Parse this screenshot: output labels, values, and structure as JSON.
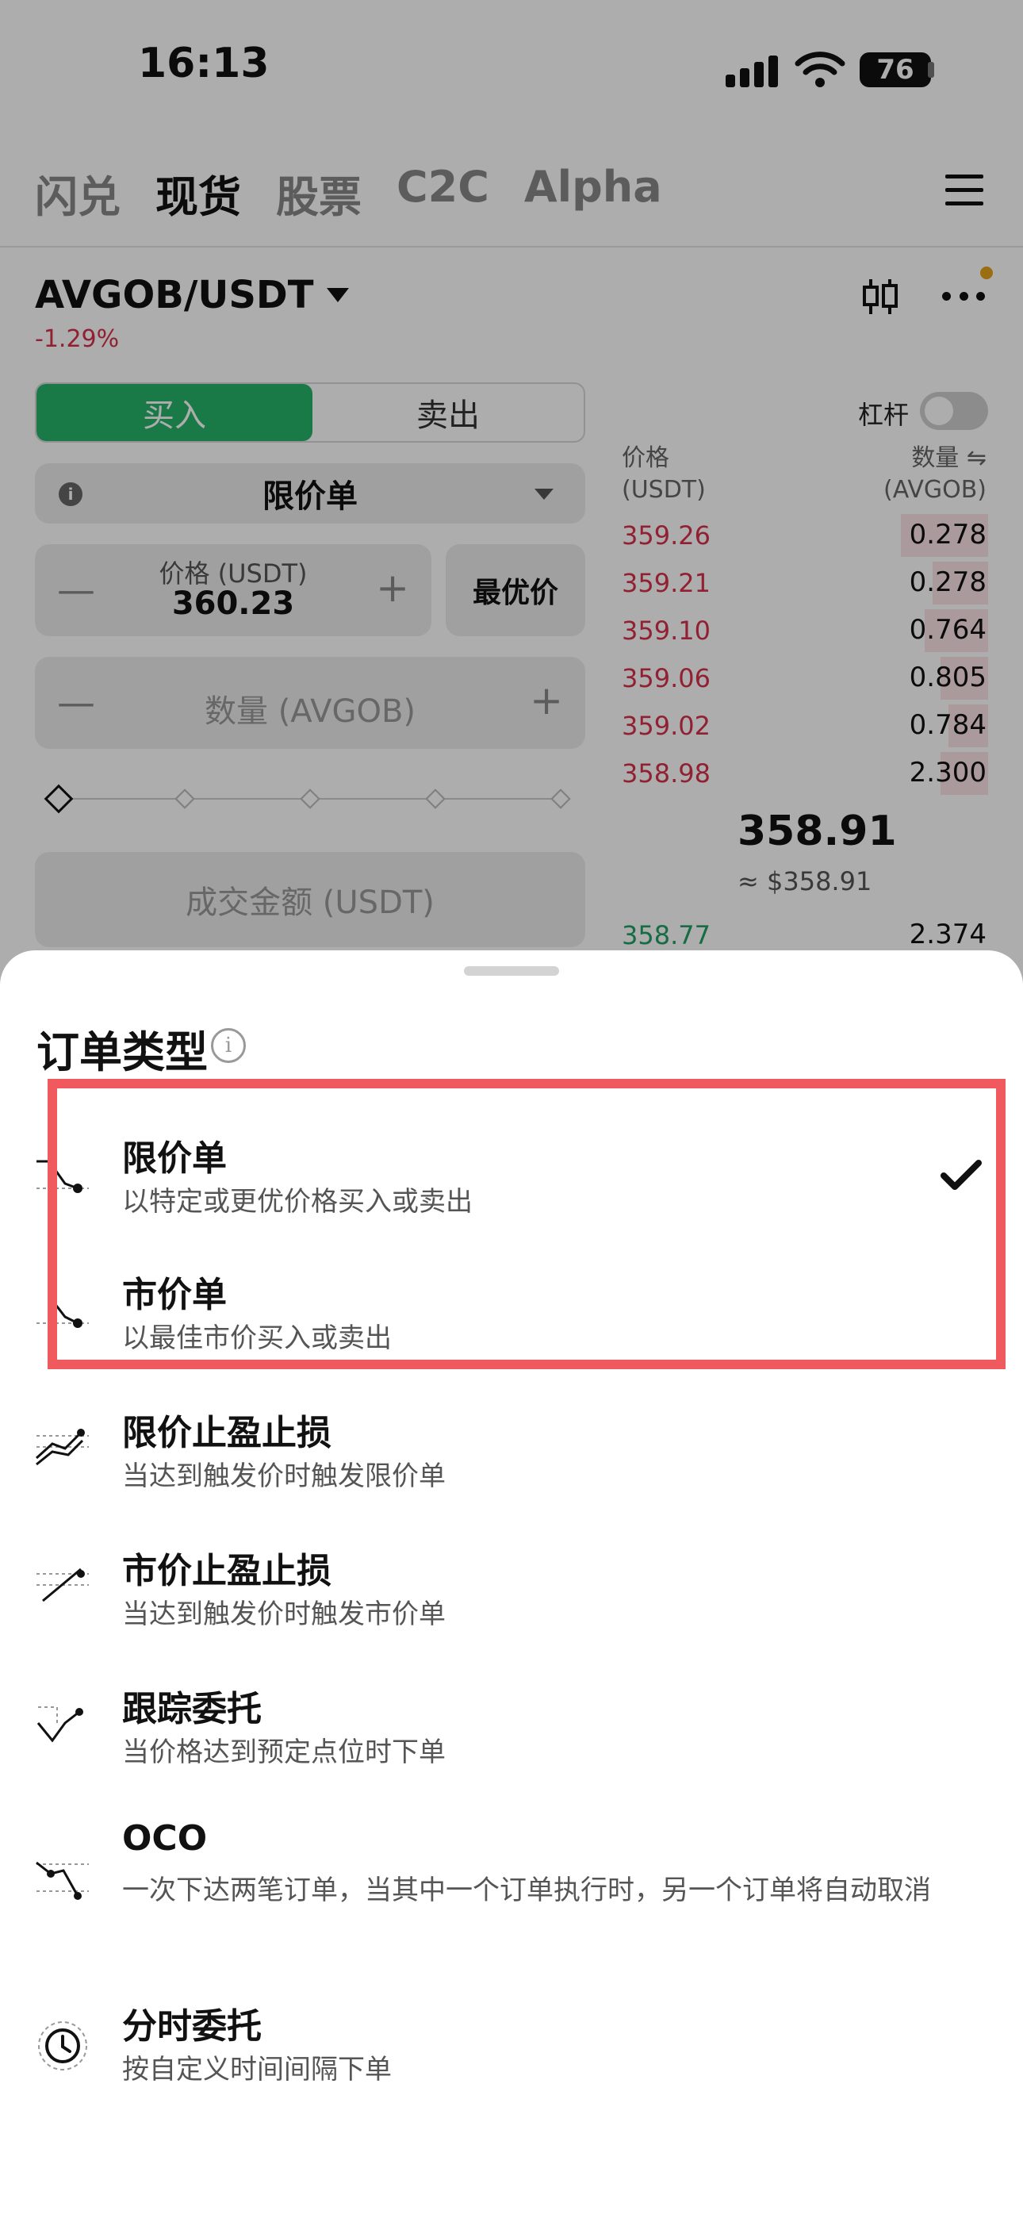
{
  "status_bar": {
    "time": "16:13",
    "battery": "76"
  },
  "nav": {
    "tabs": [
      "闪兑",
      "现货",
      "股票",
      "C2C",
      "Alpha"
    ],
    "active_index": 1
  },
  "pair": {
    "symbol": "AVGOB/USDT",
    "change": "-1.29%"
  },
  "trade": {
    "buy_label": "买入",
    "sell_label": "卖出",
    "leverage_label": "杠杆",
    "order_type": "限价单",
    "price_label": "价格 (USDT)",
    "price_value": "360.23",
    "best_price_label": "最优价",
    "quantity_placeholder": "数量 (AVGOB)",
    "amount_placeholder": "成交金额 (USDT)"
  },
  "order_book": {
    "price_header": "价格",
    "price_unit": "(USDT)",
    "qty_header": "数量 ⇋",
    "qty_unit": "(AVGOB)",
    "asks": [
      {
        "price": "359.26",
        "qty": "0.278"
      },
      {
        "price": "359.21",
        "qty": "0.278"
      },
      {
        "price": "359.10",
        "qty": "0.764"
      },
      {
        "price": "359.06",
        "qty": "0.805"
      },
      {
        "price": "359.02",
        "qty": "0.784"
      },
      {
        "price": "358.98",
        "qty": "2.300"
      }
    ],
    "mid_price": "358.91",
    "mid_usd": "≈ $358.91",
    "first_bid": {
      "price": "358.77",
      "qty": "2.374"
    }
  },
  "sheet": {
    "title": "订单类型",
    "options": [
      {
        "title": "限价单",
        "desc": "以特定或更优价格买入或卖出",
        "icon": "limit-order-icon",
        "selected": true
      },
      {
        "title": "市价单",
        "desc": "以最佳市价买入或卖出",
        "icon": "market-order-icon",
        "selected": false
      },
      {
        "title": "限价止盈止损",
        "desc": "当达到触发价时触发限价单",
        "icon": "limit-tp-sl-icon",
        "selected": false
      },
      {
        "title": "市价止盈止损",
        "desc": "当达到触发价时触发市价单",
        "icon": "market-tp-sl-icon",
        "selected": false
      },
      {
        "title": "跟踪委托",
        "desc": "当价格达到预定点位时下单",
        "icon": "trailing-order-icon",
        "selected": false
      },
      {
        "title": "OCO",
        "desc": "一次下达两笔订单，当其中一个订单执行时，另一个订单将自动取消",
        "icon": "oco-order-icon",
        "selected": false
      },
      {
        "title": "分时委托",
        "desc": "按自定义时间间隔下单",
        "icon": "twap-order-icon",
        "selected": false
      }
    ]
  },
  "colors": {
    "buy_green": "#26b46b",
    "ask_red": "#d6324a",
    "highlight_red": "#f0595e"
  }
}
